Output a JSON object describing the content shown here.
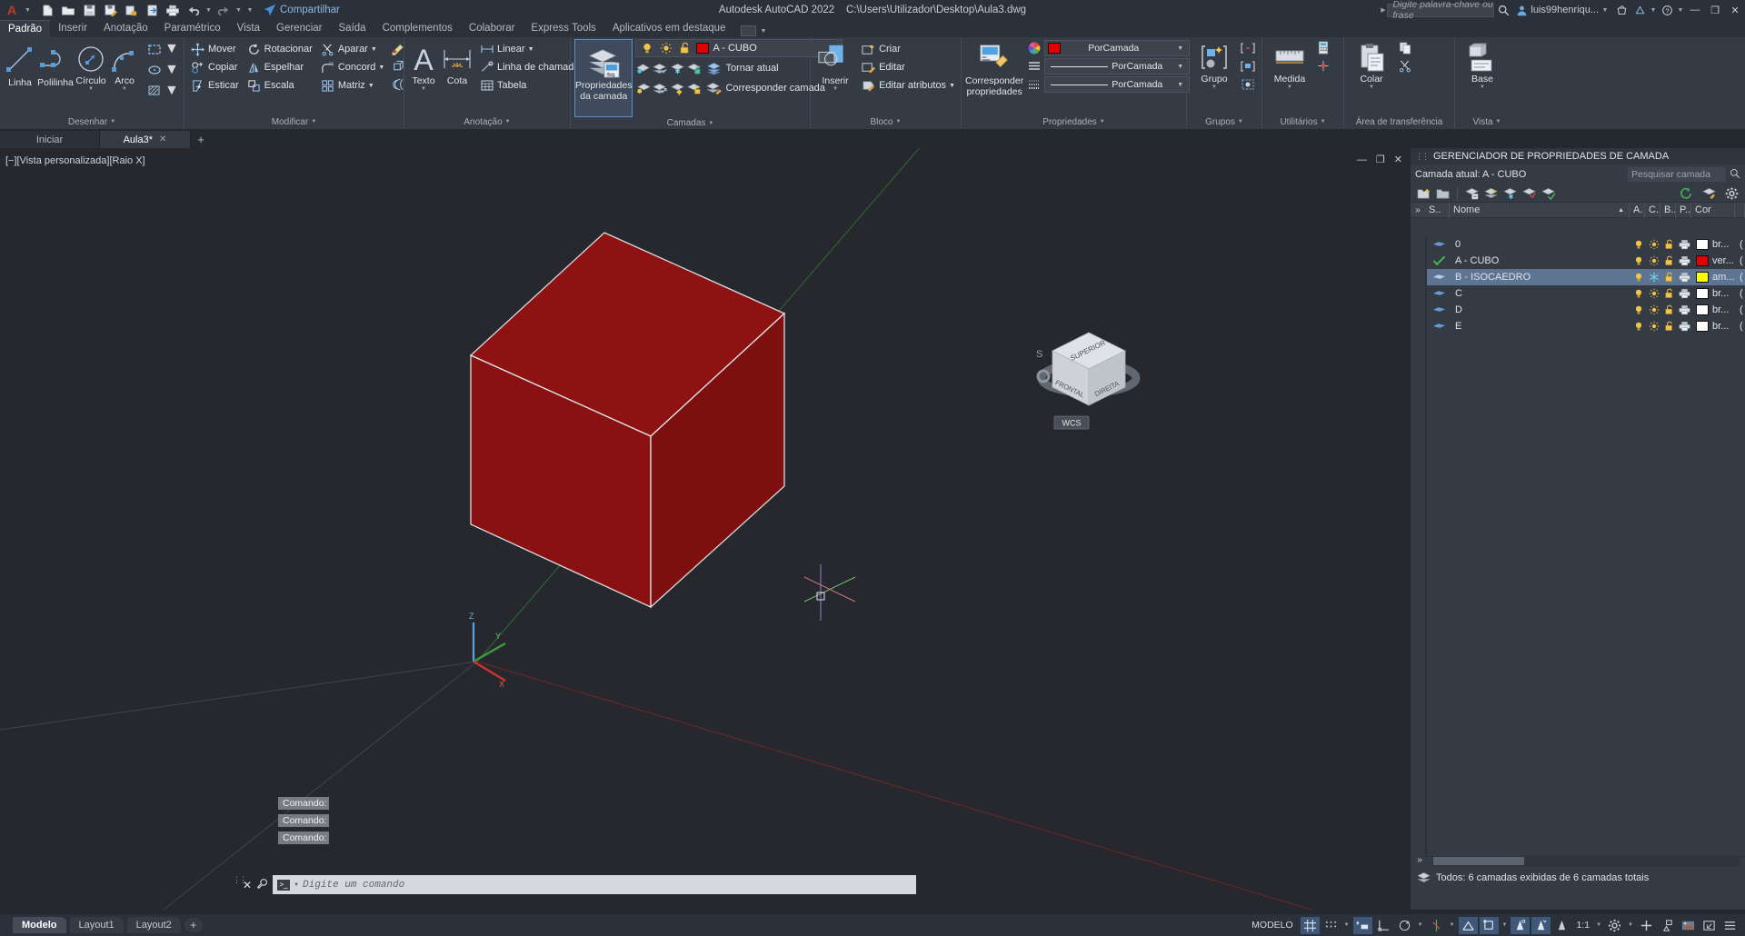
{
  "titlebar": {
    "app_title": "Autodesk AutoCAD 2022",
    "file_path": "C:\\Users\\Utilizador\\Desktop\\Aula3.dwg",
    "share_label": "Compartilhar",
    "search_placeholder": "Digite palavra-chave ou frase",
    "user_name": "luis99henriqu...",
    "quick_access": [
      {
        "name": "new-file-icon"
      },
      {
        "name": "open-file-icon"
      },
      {
        "name": "save-icon"
      },
      {
        "name": "save-as-icon"
      },
      {
        "name": "plot-preview-icon"
      },
      {
        "name": "export-icon"
      },
      {
        "name": "print-icon"
      },
      {
        "name": "undo-icon"
      },
      {
        "name": "redo-icon"
      },
      {
        "name": "qat-more-icon"
      }
    ],
    "window_buttons": [
      "minimize",
      "restore",
      "close"
    ]
  },
  "ribbon_tabs": [
    {
      "label": "Padrão",
      "active": true
    },
    {
      "label": "Inserir",
      "active": false
    },
    {
      "label": "Anotação",
      "active": false
    },
    {
      "label": "Paramétrico",
      "active": false
    },
    {
      "label": "Vista",
      "active": false
    },
    {
      "label": "Gerenciar",
      "active": false
    },
    {
      "label": "Saída",
      "active": false
    },
    {
      "label": "Complementos",
      "active": false
    },
    {
      "label": "Colaborar",
      "active": false
    },
    {
      "label": "Express Tools",
      "active": false
    },
    {
      "label": "Aplicativos em destaque",
      "active": false
    }
  ],
  "ribbon": {
    "panels": [
      {
        "title": "Desenhar",
        "big_buttons": [
          {
            "label": "Linha",
            "icon": "line-icon",
            "dropdown": false
          },
          {
            "label": "Polilinha",
            "icon": "polyline-icon",
            "dropdown": false
          },
          {
            "label": "Círculo",
            "icon": "circle-icon",
            "dropdown": true
          },
          {
            "label": "Arco",
            "icon": "arc-icon",
            "dropdown": true
          }
        ],
        "small_icons": [
          {
            "name": "rectangle-icon",
            "dropdown": true
          },
          {
            "name": "ellipse-icon",
            "dropdown": true
          },
          {
            "name": "hatch-icon",
            "dropdown": true
          }
        ]
      },
      {
        "title": "Modificar",
        "items": [
          {
            "label": "Mover",
            "icon": "move-icon"
          },
          {
            "label": "Copiar",
            "icon": "copy-icon"
          },
          {
            "label": "Esticar",
            "icon": "stretch-icon"
          },
          {
            "label": "Rotacionar",
            "icon": "rotate-icon"
          },
          {
            "label": "Espelhar",
            "icon": "mirror-icon"
          },
          {
            "label": "Escala",
            "icon": "scale-icon"
          },
          {
            "label": "Aparar",
            "icon": "trim-icon",
            "dropdown": true
          },
          {
            "label": "Concord",
            "icon": "fillet-icon",
            "dropdown": true
          },
          {
            "label": "Matriz",
            "icon": "array-icon",
            "dropdown": true
          }
        ],
        "extra_icons": [
          {
            "name": "erase-icon"
          },
          {
            "name": "explode-icon"
          },
          {
            "name": "offset-icon"
          }
        ]
      },
      {
        "title": "Anotação",
        "big_buttons": [
          {
            "label": "Texto",
            "icon": "text-icon",
            "dropdown": true
          },
          {
            "label": "Cota",
            "icon": "dimension-icon",
            "dropdown": false
          }
        ],
        "items": [
          {
            "label": "Linear",
            "icon": "linear-dim-icon",
            "dropdown": true
          },
          {
            "label": "Linha de chamada",
            "icon": "leader-icon",
            "dropdown": true
          },
          {
            "label": "Tabela",
            "icon": "table-icon",
            "dropdown": false
          }
        ]
      },
      {
        "title": "Camadas",
        "big_button": {
          "label_line1": "Propriedades",
          "label_line2": "da camada",
          "icon": "layer-properties-icon",
          "active": true
        },
        "layer_combo": {
          "value": "A - CUBO",
          "color": "#e00000",
          "icons": [
            "lightbulb-on-icon",
            "sun-icon",
            "unlock-icon"
          ]
        },
        "items": [
          {
            "label": "Tornar atual",
            "icon": "make-current-icon"
          },
          {
            "label": "Corresponder camada",
            "icon": "match-layer-icon"
          }
        ],
        "row1_icons": [
          "layer-isolate-icon",
          "layer-off-icon",
          "layer-freeze-icon",
          "layer-lock-icon"
        ],
        "row2_icons": [
          "layer-unisolate-icon",
          "layer-on-icon",
          "layer-thaw-icon",
          "layer-unlock-icon"
        ]
      },
      {
        "title": "Bloco",
        "big_button": {
          "label": "Inserir",
          "icon": "insert-block-icon",
          "dropdown": true
        },
        "items": [
          {
            "label": "Criar",
            "icon": "create-block-icon"
          },
          {
            "label": "Editar",
            "icon": "edit-block-icon"
          },
          {
            "label": "Editar atributos",
            "icon": "edit-attributes-icon",
            "dropdown": true
          }
        ]
      },
      {
        "title": "Propriedades",
        "big_button": {
          "label_line1": "Corresponder",
          "label_line2": "propriedades",
          "icon": "match-properties-icon"
        },
        "combos": [
          {
            "value": "PorCamada",
            "type": "color",
            "color": "#e00000",
            "icon": "color-wheel-icon"
          },
          {
            "value": "PorCamada",
            "type": "linetype",
            "icon": "linetype-icon"
          },
          {
            "value": "PorCamada",
            "type": "lineweight",
            "icon": "lineweight-icon"
          }
        ]
      },
      {
        "title": "Grupos",
        "big_button": {
          "label": "Grupo",
          "icon": "group-icon",
          "dropdown": true
        },
        "small_icons": [
          "ungroup-icon",
          "group-edit-icon",
          "group-selection-icon"
        ]
      },
      {
        "title": "Utilitários",
        "big_button": {
          "label": "Medida",
          "icon": "measure-icon",
          "dropdown": true
        },
        "small_icons": [
          "quick-calc-icon",
          "id-point-icon"
        ]
      },
      {
        "title": "Área de transferência",
        "big_button": {
          "label": "Colar",
          "icon": "paste-icon",
          "dropdown": true
        },
        "small_icons": [
          "copy-clip-icon",
          "cut-clip-icon"
        ]
      },
      {
        "title": "Vista",
        "big_button": {
          "label": "Base",
          "icon": "base-view-icon",
          "dropdown": true
        }
      }
    ]
  },
  "document_tabs": [
    {
      "label": "Iniciar",
      "active": false,
      "closable": false
    },
    {
      "label": "Aula3*",
      "active": true,
      "closable": true
    }
  ],
  "document_tab_plus": "+",
  "canvas": {
    "viewport_label": "[−][Vista personalizada][Raio X]",
    "viewcube": {
      "top": "SUPERIOR",
      "front": "FRONTAL",
      "right": "DIREITA",
      "wcs_label": "WCS"
    },
    "ucs": {
      "x": "X",
      "y": "Y",
      "z": "Z"
    },
    "model_color": "#8e1212",
    "model_edge_color": "#d6d6d6",
    "window_buttons": [
      "minimize",
      "restore",
      "close"
    ]
  },
  "command_line": {
    "history": [
      "Comando:",
      "Comando:",
      "Comando:"
    ],
    "placeholder": "Digite um comando",
    "close_icon": "close-icon",
    "customize_icon": "wrench-icon"
  },
  "layer_palette": {
    "title": "GERENCIADOR DE PROPRIEDADES DE CAMADA",
    "current_layer_label": "Camada atual: A - CUBO",
    "search_placeholder": "Pesquisar camada",
    "toolbar_icons": [
      "new-layer-icon",
      "new-layer-vp-frozen-icon",
      "delete-layer-icon",
      "set-current-icon",
      "layer-states-icon",
      "layer-filter-icon",
      "layer-check-icon"
    ],
    "toolbar_right_icons": [
      "refresh-icon",
      "layer-tools-icon",
      "settings-gear-icon"
    ],
    "columns": [
      "S..",
      "Nome",
      "A.",
      "C.",
      "B..",
      "P..",
      "Cor"
    ],
    "rows": [
      {
        "status": "layer-icon",
        "name": "0",
        "on": "lightbulb-on-icon",
        "freeze": "sun-icon",
        "lock": "unlock-icon",
        "plot": "printer-icon",
        "color_swatch": "#ffffff",
        "color": "br...",
        "selected": false
      },
      {
        "status": "current-check-icon",
        "name": "A - CUBO",
        "on": "lightbulb-on-icon",
        "freeze": "sun-icon",
        "lock": "unlock-icon",
        "plot": "printer-icon",
        "color_swatch": "#e00000",
        "color": "ver...",
        "selected": false
      },
      {
        "status": "layer-icon",
        "name": "B - ISOCAEDRO",
        "on": "lightbulb-on-icon",
        "freeze": "snowflake-icon",
        "lock": "unlock-icon",
        "plot": "printer-icon",
        "color_swatch": "#ffff00",
        "color": "am...",
        "selected": true
      },
      {
        "status": "layer-icon",
        "name": "C",
        "on": "lightbulb-on-icon",
        "freeze": "sun-icon",
        "lock": "unlock-icon",
        "plot": "printer-icon",
        "color_swatch": "#ffffff",
        "color": "br...",
        "selected": false
      },
      {
        "status": "layer-icon",
        "name": "D",
        "on": "lightbulb-on-icon",
        "freeze": "sun-icon",
        "lock": "unlock-icon",
        "plot": "printer-icon",
        "color_swatch": "#ffffff",
        "color": "br...",
        "selected": false
      },
      {
        "status": "layer-icon",
        "name": "E",
        "on": "lightbulb-on-icon",
        "freeze": "sun-icon",
        "lock": "unlock-icon",
        "plot": "printer-icon",
        "color_swatch": "#ffffff",
        "color": "br...",
        "selected": false
      }
    ],
    "status_text": "Todos: 6 camadas exibidas de 6 camadas totais",
    "expand_icon": "chevron-double-right-icon"
  },
  "layout_tabs": [
    {
      "label": "Modelo",
      "active": true
    },
    {
      "label": "Layout1",
      "active": false
    },
    {
      "label": "Layout2",
      "active": false
    }
  ],
  "layout_tab_plus": "+",
  "status_bar": {
    "space_label": "MODELO",
    "scale": "1:1",
    "items": [
      {
        "name": "grid-display-toggle",
        "icon": "grid-icon",
        "on": true
      },
      {
        "name": "snap-mode-toggle",
        "icon": "snap-dots-icon",
        "on": false,
        "dropdown": true
      },
      {
        "name": "infer-constraints-toggle",
        "icon": "infer-icon",
        "on": true
      },
      {
        "name": "ortho-mode-toggle",
        "icon": "ortho-icon",
        "on": false
      },
      {
        "name": "polar-tracking-toggle",
        "icon": "polar-icon",
        "on": false,
        "dropdown": true
      },
      {
        "name": "isometric-draft-toggle",
        "icon": "isometric-icon",
        "on": false,
        "dropdown": true
      },
      {
        "name": "object-snap-tracking-toggle",
        "icon": "osnap-track-icon",
        "on": true
      },
      {
        "name": "object-snap-toggle",
        "icon": "osnap-icon",
        "on": true,
        "dropdown": true
      },
      {
        "name": "lineweight-toggle",
        "icon": "lineweight-display-icon",
        "on": true
      },
      {
        "name": "transparency-toggle",
        "icon": "transparency-icon",
        "on": true
      },
      {
        "name": "selection-cycling-toggle",
        "icon": "selection-cycle-icon",
        "on": false
      },
      {
        "name": "annotation-scale",
        "icon": "annotation-scale-icon",
        "on": false,
        "dropdown": true
      },
      {
        "name": "workspace-switch",
        "icon": "gear-icon",
        "on": false,
        "dropdown": true
      },
      {
        "name": "hardware-accel",
        "icon": "plus-icon",
        "on": false
      },
      {
        "name": "isolate-objects",
        "icon": "isolate-icon",
        "on": false
      },
      {
        "name": "graphics-perf",
        "icon": "graphics-icon",
        "on": false
      },
      {
        "name": "clean-screen",
        "icon": "fullscreen-icon",
        "on": false
      },
      {
        "name": "customization",
        "icon": "hamburger-icon",
        "on": false
      }
    ]
  }
}
